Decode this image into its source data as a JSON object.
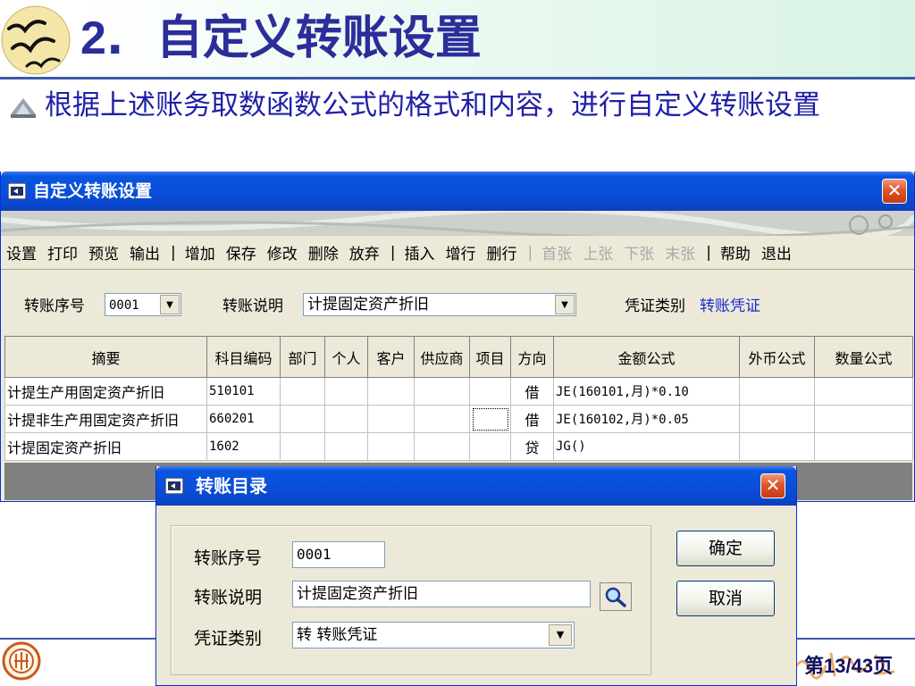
{
  "slide": {
    "title_num": "2",
    "title_dot": ".",
    "title_text": "自定义转账设置",
    "bullet": "根据上述账务取数函数公式的格式和内容，进行自定义转账设置",
    "page_number": "第13/43页"
  },
  "main_window": {
    "title": "自定义转账设置",
    "close": "✕",
    "toolbar": [
      {
        "label": "设置",
        "enabled": true
      },
      {
        "label": "打印",
        "enabled": true
      },
      {
        "label": "预览",
        "enabled": true
      },
      {
        "label": "输出",
        "enabled": true
      },
      {
        "label": "|",
        "enabled": true
      },
      {
        "label": "增加",
        "enabled": true
      },
      {
        "label": "保存",
        "enabled": true
      },
      {
        "label": "修改",
        "enabled": true
      },
      {
        "label": "删除",
        "enabled": true
      },
      {
        "label": "放弃",
        "enabled": true
      },
      {
        "label": "|",
        "enabled": true
      },
      {
        "label": "插入",
        "enabled": true
      },
      {
        "label": "增行",
        "enabled": true
      },
      {
        "label": "删行",
        "enabled": true
      },
      {
        "label": "|",
        "enabled": false
      },
      {
        "label": "首张",
        "enabled": false
      },
      {
        "label": "上张",
        "enabled": false
      },
      {
        "label": "下张",
        "enabled": false
      },
      {
        "label": "末张",
        "enabled": false
      },
      {
        "label": "|",
        "enabled": true
      },
      {
        "label": "帮助",
        "enabled": true
      },
      {
        "label": "退出",
        "enabled": true
      }
    ],
    "form": {
      "seq_label": "转账序号",
      "seq_value": "0001",
      "desc_label": "转账说明",
      "desc_value": "计提固定资产折旧",
      "voucher_label": "凭证类别",
      "voucher_value": "转账凭证"
    },
    "grid": {
      "headers": [
        "摘要",
        "科目编码",
        "部门",
        "个人",
        "客户",
        "供应商",
        "项目",
        "方向",
        "金额公式",
        "外币公式",
        "数量公式"
      ],
      "rows": [
        [
          "计提生产用固定资产折旧",
          "510101",
          "",
          "",
          "",
          "",
          "",
          "借",
          "JE(160101,月)*0.10",
          "",
          ""
        ],
        [
          "计提非生产用固定资产折旧",
          "660201",
          "",
          "",
          "",
          "",
          "",
          "借",
          "JE(160102,月)*0.05",
          "",
          ""
        ],
        [
          "计提固定资产折旧",
          "1602",
          "",
          "",
          "",
          "",
          "",
          "贷",
          "JG()",
          "",
          ""
        ]
      ]
    }
  },
  "dialog": {
    "title": "转账目录",
    "close": "✕",
    "seq_label": "转账序号",
    "seq_value": "0001",
    "desc_label": "转账说明",
    "desc_value": "计提固定资产折旧",
    "voucher_label": "凭证类别",
    "voucher_value": "转 转账凭证",
    "ok_label": "确定",
    "cancel_label": "取消"
  },
  "colors": {
    "title_blue": "#2b2e9a",
    "bullet_blue": "#2020a8",
    "xp_titlebar": "#0a4fd8",
    "close_red": "#e0552b"
  }
}
